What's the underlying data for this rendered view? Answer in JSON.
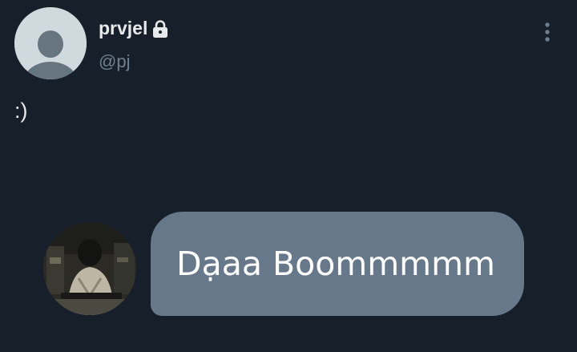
{
  "profile": {
    "display_name": "prvjel",
    "handle": "@pj",
    "locked_icon": "lock-icon",
    "avatar_icon": "default-avatar-icon"
  },
  "post": {
    "text": ":)"
  },
  "menu": {
    "icon": "more-vertical-icon"
  },
  "message": {
    "text": "Dạaa Boommmmm",
    "bubble_color": "#66788a"
  },
  "colors": {
    "background": "#17202a",
    "secondary_text": "#6e7f8f"
  }
}
